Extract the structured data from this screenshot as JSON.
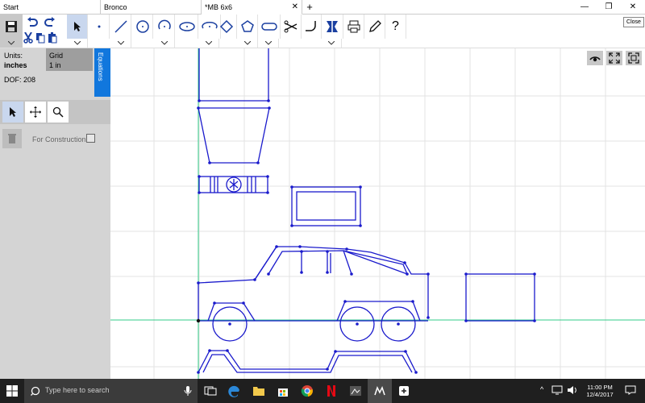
{
  "tabs": [
    {
      "label": "Start"
    },
    {
      "label": "Bronco"
    },
    {
      "label": "*MB 6x6"
    }
  ],
  "new_tab_label": "+",
  "window": {
    "close_tooltip": "Close"
  },
  "side": {
    "units_label": "Units:",
    "units_value": "inches",
    "grid_label": "Grid",
    "grid_value": "1 in",
    "dof": "DOF: 208",
    "equations_tab": "Equations",
    "for_construction": "For Construction"
  },
  "taskbar": {
    "search_placeholder": "Type here to search",
    "time": "11:00 PM",
    "date": "12/4/2017"
  },
  "colors": {
    "sketch": "#1a1acc",
    "axis_green": "#33cc88",
    "accent": "#1177dd",
    "panel": "#d4d4d4"
  }
}
